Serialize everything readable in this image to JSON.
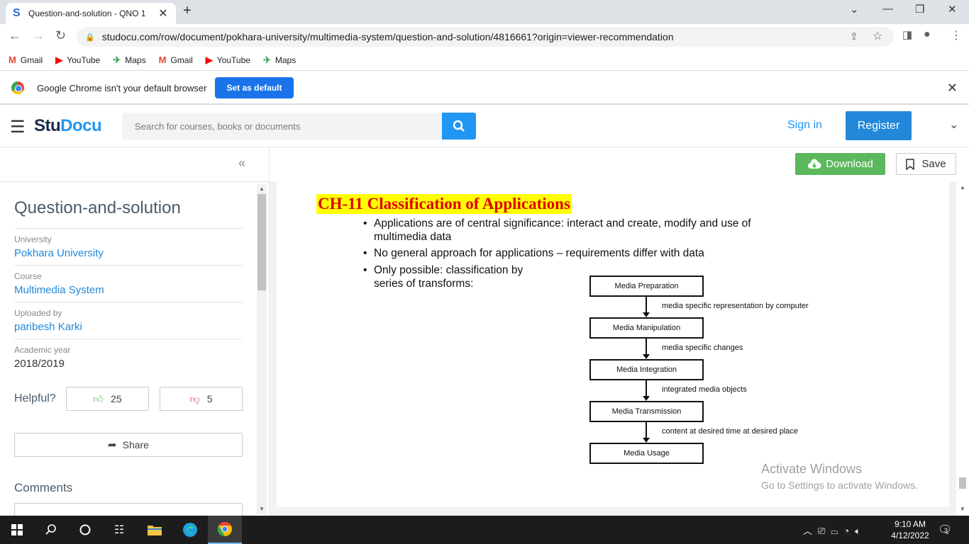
{
  "browser": {
    "tab_title": "Question-and-solution - QNO 1",
    "tab_favicon": "S",
    "url": "studocu.com/row/document/pokhara-university/multimedia-system/question-and-solution/4816661?origin=viewer-recommendation",
    "bookmarks": [
      {
        "label": "Gmail",
        "icon": "gmail-icon",
        "glyph": "M",
        "color": "#ea4335"
      },
      {
        "label": "YouTube",
        "icon": "youtube-icon",
        "glyph": "▶",
        "color": "#ff0000"
      },
      {
        "label": "Maps",
        "icon": "maps-icon",
        "glyph": "✈",
        "color": "#34a853"
      },
      {
        "label": "Gmail",
        "icon": "gmail-icon",
        "glyph": "M",
        "color": "#ea4335"
      },
      {
        "label": "YouTube",
        "icon": "youtube-icon",
        "glyph": "▶",
        "color": "#ff0000"
      },
      {
        "label": "Maps",
        "icon": "maps-icon",
        "glyph": "✈",
        "color": "#34a853"
      }
    ],
    "infobar": {
      "message": "Google Chrome isn't your default browser",
      "button": "Set as default"
    }
  },
  "header": {
    "logo_stu": "Stu",
    "logo_docu": "Docu",
    "search_placeholder": "Search for courses, books or documents",
    "signin": "Sign in",
    "register": "Register"
  },
  "sidebar": {
    "collapse": "«",
    "title": "Question-and-solution",
    "meta": [
      {
        "label": "University",
        "value": "Pokhara University",
        "link": true
      },
      {
        "label": "Course",
        "value": "Multimedia System",
        "link": true
      },
      {
        "label": "Uploaded by",
        "value": "paribesh Karki",
        "link": true
      },
      {
        "label": "Academic year",
        "value": "2018/2019",
        "link": false
      }
    ],
    "helpful_label": "Helpful?",
    "upvotes": "25",
    "downvotes": "5",
    "share": "Share",
    "comments": "Comments"
  },
  "toolbar": {
    "download": "Download",
    "save": "Save"
  },
  "slide": {
    "title": "CH-11 Classification of Applications",
    "bullets": [
      {
        "line1": "Applications are of central significance: interact and create, modify and use of",
        "line2": "multimedia data"
      },
      {
        "line1": "No general approach for applications – requirements differ with data",
        "line2": ""
      },
      {
        "line1": "Only possible: classification by",
        "line2": "series of transforms:"
      }
    ],
    "flow_boxes": [
      "Media Preparation",
      "Media Manipulation",
      "Media Integration",
      "Media Transmission",
      "Media Usage"
    ],
    "flow_edges": [
      "media specific representation by computer",
      "media specific changes",
      "integrated media objects",
      "content at desired time at desired place"
    ]
  },
  "watermark": {
    "line1": "Activate Windows",
    "line2": "Go to Settings to activate Windows."
  },
  "taskbar": {
    "time": "9:10 AM",
    "date": "4/12/2022",
    "notifications": "3"
  }
}
